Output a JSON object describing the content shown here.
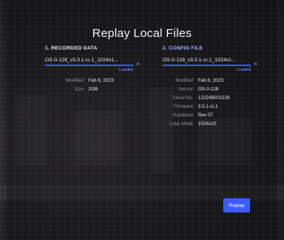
{
  "dialog": {
    "title": "Replay Local Files"
  },
  "recorded_data": {
    "heading": "1. RECORDED DATA",
    "file_name": "OS-0-128_v3.0.1-rc.1_1024x1...",
    "status": "Loaded",
    "progress": 1.0,
    "meta": [
      {
        "key": "Modified",
        "value": "Feb 6, 2023"
      },
      {
        "key": "Size",
        "value": "2GB"
      }
    ]
  },
  "config_file": {
    "heading": "2. CONFIG FILE",
    "file_name": "OS-0-128_v3.0.1-rc.1_1024x1...",
    "status": "Loaded",
    "progress": 1.0,
    "meta": [
      {
        "key": "Modified",
        "value": "Feb 6, 2023"
      },
      {
        "key": "Sensor",
        "value": "OS-0-128"
      },
      {
        "key": "Serial No.",
        "value": "122246001228"
      },
      {
        "key": "Firmware",
        "value": "3.0.1-rc.1"
      },
      {
        "key": "Hardware",
        "value": "Rev 07"
      },
      {
        "key": "Lidar Mode",
        "value": "1024x10"
      }
    ]
  },
  "actions": {
    "replay_label": "Replay"
  },
  "colors": {
    "accent": "#3b5bff",
    "accent_text": "#7f93ff"
  },
  "icons": {
    "remove_file": "close-icon"
  }
}
